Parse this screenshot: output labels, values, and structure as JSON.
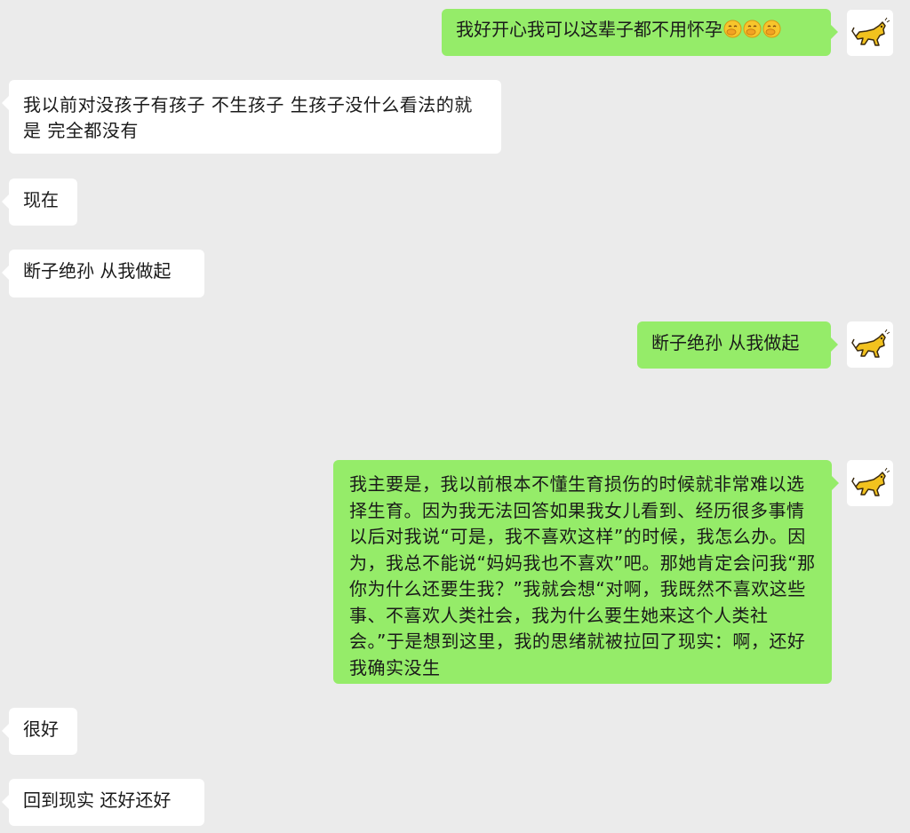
{
  "colors": {
    "background": "#ebebeb",
    "sent_bubble": "#95ec69",
    "received_bubble": "#ffffff",
    "text": "#1a1a1a"
  },
  "self_avatar": {
    "icon": "yellow-cat-avatar-icon"
  },
  "messages": [
    {
      "side": "right",
      "text": "我好开心我可以这辈子都不用怀孕",
      "emoji_count": 3,
      "emoji_icon": "hand-over-mouth-emoji-icon"
    },
    {
      "side": "left",
      "text": "我以前对没孩子有孩子 不生孩子 生孩子没什么看法的就是 完全都没有"
    },
    {
      "side": "left",
      "text": "现在"
    },
    {
      "side": "left",
      "text": "断子绝孙 从我做起"
    },
    {
      "side": "right",
      "text": "断子绝孙 从我做起"
    },
    {
      "side": "right",
      "text": "我主要是，我以前根本不懂生育损伤的时候就非常难以选择生育。因为我无法回答如果我女儿看到、经历很多事情以后对我说“可是，我不喜欢这样”的时候，我怎么办。因为，我总不能说“妈妈我也不喜欢”吧。那她肯定会问我“那你为什么还要生我？”我就会想“对啊，我既然不喜欢这些事、不喜欢人类社会，我为什么要生她来这个人类社会。”于是想到这里，我的思绪就被拉回了现实：啊，还好我确实没生"
    },
    {
      "side": "left",
      "text": "很好"
    },
    {
      "side": "left",
      "text": "回到现实 还好还好"
    }
  ]
}
